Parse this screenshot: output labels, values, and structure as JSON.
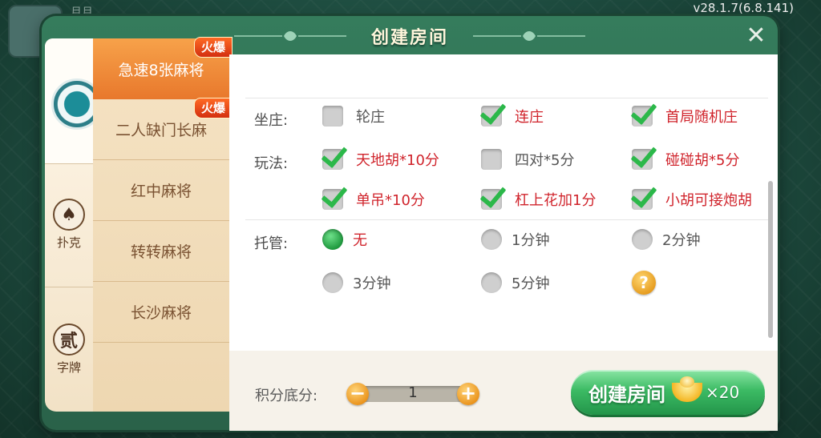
{
  "version": "v28.1.7(6.8.141)",
  "background": {
    "name_fragment": "月月"
  },
  "dialog": {
    "title": "创建房间",
    "close_icon": "close-icon"
  },
  "categories": [
    {
      "label": "",
      "icon": "mahjong-emblem-icon"
    },
    {
      "label": "扑克",
      "icon": "spade-icon",
      "glyph": "♠"
    },
    {
      "label": "字牌",
      "icon": "er-tile-icon",
      "glyph": "贰"
    }
  ],
  "games": [
    {
      "label": "急速8张麻将",
      "hot": "火爆",
      "active": true
    },
    {
      "label": "二人缺门长麻",
      "hot": "火爆",
      "active": false
    },
    {
      "label": "红中麻将",
      "hot": "",
      "active": false
    },
    {
      "label": "转转麻将",
      "hot": "",
      "active": false
    },
    {
      "label": "长沙麻将",
      "hot": "",
      "active": false
    }
  ],
  "settings": {
    "dealer": {
      "label": "坐庄:",
      "options": [
        {
          "label": "轮庄",
          "checked": false
        },
        {
          "label": "连庄",
          "checked": true
        },
        {
          "label": "首局随机庄",
          "checked": true
        }
      ]
    },
    "rules": {
      "label": "玩法:",
      "options": [
        {
          "label": "天地胡*10分",
          "checked": true
        },
        {
          "label": "四对*5分",
          "checked": false
        },
        {
          "label": "碰碰胡*5分",
          "checked": true
        },
        {
          "label": "单吊*10分",
          "checked": true
        },
        {
          "label": "杠上花加1分",
          "checked": true
        },
        {
          "label": "小胡可接炮胡",
          "checked": true
        }
      ]
    },
    "auto_play": {
      "label": "托管:",
      "options": [
        {
          "label": "无",
          "selected": true
        },
        {
          "label": "1分钟",
          "selected": false
        },
        {
          "label": "2分钟",
          "selected": false
        },
        {
          "label": "3分钟",
          "selected": false
        },
        {
          "label": "5分钟",
          "selected": false
        }
      ],
      "help": "?"
    }
  },
  "footer": {
    "score_label": "积分底分:",
    "score_value": "1",
    "minus": "−",
    "plus": "+",
    "create_label": "创建房间",
    "cost": "×20"
  },
  "colors": {
    "accent_orange": "#e8782c",
    "check_green": "#2cb84a",
    "selected_text_red": "#d0242c",
    "primary_button_green": "#3cbb64"
  }
}
